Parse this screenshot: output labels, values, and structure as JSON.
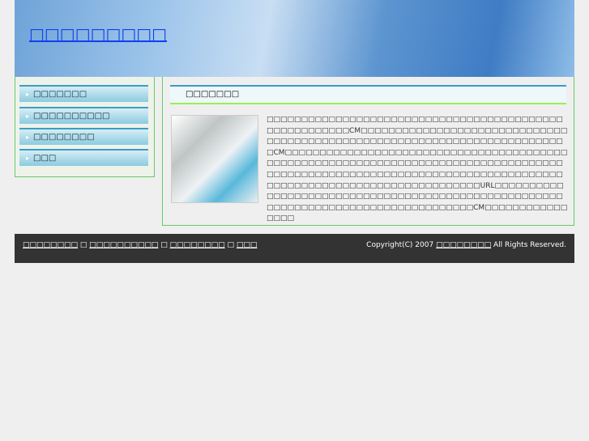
{
  "header": {
    "title": "□□□□□□□□□"
  },
  "sidebar": {
    "items": [
      {
        "label": "□□□□□□□"
      },
      {
        "label": "□□□□□□□□□□"
      },
      {
        "label": "□□□□□□□□"
      },
      {
        "label": "□□□"
      }
    ]
  },
  "main": {
    "heading": "□□□□□□□",
    "body": "□□□□□□□□□□□□□□□□□□□□□□□□□□□□□□□□□□□□□□□□□□□□□□□□□□□□□□□CM□□□□□□□□□□□□□□□□□□□□□□□□□□□□□□□□□□□□□□□□□□□□□□□□□□□□□□□□□□□□□□□□□□□□□□□□□□CM□□□□□□□□□□□□□□□□□□□□□□□□□□□□□□□□□□□□□□□□□□□□□□□□□□□□□□□□□□□□□□□□□□□□□□□□□□□□□□□□□□□□□□□□□□□□□□□□□□□□□□□□□□□□□□□□□□□□□□□□□□□□□□□□□□□□□□□□□□□□□□□□□□□□□□□□□□□□□□URL□□□□□□□□□□□□□□□□□□□□□□□□□□□□□□□□□□□□□□□□□□□□□□□□□□□□□□□□□□□□□□□□□□□□□□□□□□□□□□□□□□□CM□□□□□□□□□□□□□□□□"
  },
  "footer": {
    "links": [
      "□□□□□□□□",
      "□□□□□□□□□□",
      "□□□□□□□□",
      "□□□"
    ],
    "sep": "□",
    "copy_prefix": "Copyright(C) 2007 ",
    "copy_link": "□□□□□□□□",
    "copy_suffix": " All Rights Reserved."
  }
}
